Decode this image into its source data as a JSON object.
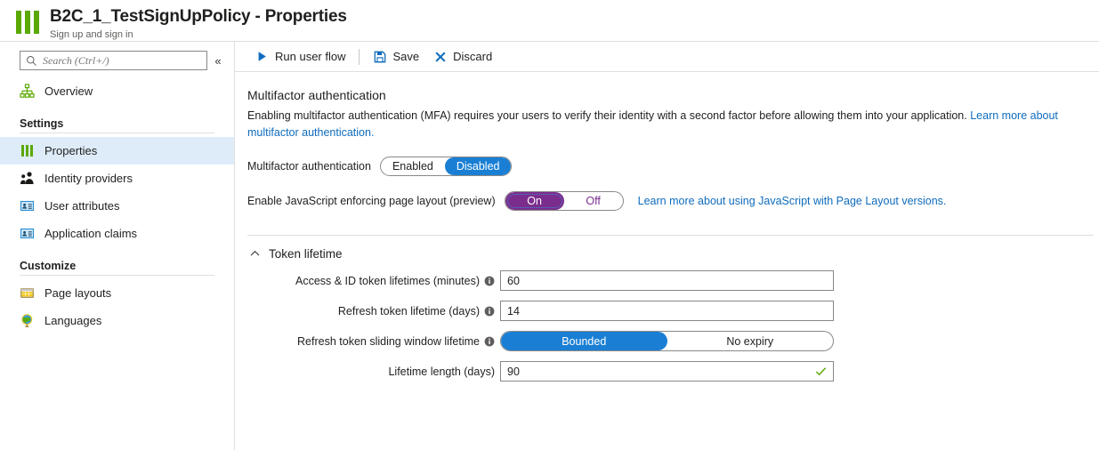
{
  "header": {
    "title": "B2C_1_TestSignUpPolicy - Properties",
    "subtitle": "Sign up and sign in",
    "icon": "bars-green-icon",
    "accent_green": "#5ba800"
  },
  "sidebar": {
    "search": {
      "placeholder": "Search (Ctrl+/)",
      "value": "",
      "icon": "search-icon"
    },
    "collapse_label": "«",
    "top_items": [
      {
        "label": "Overview",
        "icon": "hierarchy-icon",
        "selected": false
      }
    ],
    "groups": [
      {
        "title": "Settings",
        "items": [
          {
            "label": "Properties",
            "icon": "bars-green-icon",
            "selected": true
          },
          {
            "label": "Identity providers",
            "icon": "people-icon",
            "selected": false
          },
          {
            "label": "User attributes",
            "icon": "id-card-icon",
            "selected": false
          },
          {
            "label": "Application claims",
            "icon": "id-card-icon",
            "selected": false
          }
        ]
      },
      {
        "title": "Customize",
        "items": [
          {
            "label": "Page layouts",
            "icon": "table-grid-icon",
            "selected": false
          },
          {
            "label": "Languages",
            "icon": "globe-icon",
            "selected": false
          }
        ]
      }
    ]
  },
  "toolbar": {
    "run_label": "Run user flow",
    "run_icon": "play-icon",
    "save_label": "Save",
    "save_icon": "save-icon",
    "discard_label": "Discard",
    "discard_icon": "close-x-icon"
  },
  "mfa": {
    "section_title": "Multifactor authentication",
    "description_pre": "Enabling multifactor authentication (MFA) requires your users to verify their identity with a second factor before allowing them into your application. ",
    "description_link": "Learn more about multifactor authentication.",
    "field_label": "Multifactor authentication",
    "options": [
      "Enabled",
      "Disabled"
    ],
    "selected": "Disabled",
    "accent_blue": "#1a7fd4"
  },
  "javascript": {
    "field_label": "Enable JavaScript enforcing page layout (preview)",
    "options": [
      "On",
      "Off"
    ],
    "selected": "On",
    "link": "Learn more about using JavaScript with Page Layout versions.",
    "accent_purple": "#7b2d8e"
  },
  "token_lifetime": {
    "section_title": "Token lifetime",
    "chevron": "chevron-up-icon",
    "expanded": true,
    "fields": [
      {
        "label": "Access & ID token lifetimes (minutes)",
        "info": true,
        "type": "text",
        "value": "60",
        "valid_check": false
      },
      {
        "label": "Refresh token lifetime (days)",
        "info": true,
        "type": "text",
        "value": "14",
        "valid_check": false
      },
      {
        "label": "Refresh token sliding window lifetime",
        "info": true,
        "type": "toggle",
        "options": [
          "Bounded",
          "No expiry"
        ],
        "selected": "Bounded"
      },
      {
        "label": "Lifetime length (days)",
        "info": false,
        "type": "text",
        "value": "90",
        "valid_check": true
      }
    ],
    "valid_color": "#5ba800"
  }
}
